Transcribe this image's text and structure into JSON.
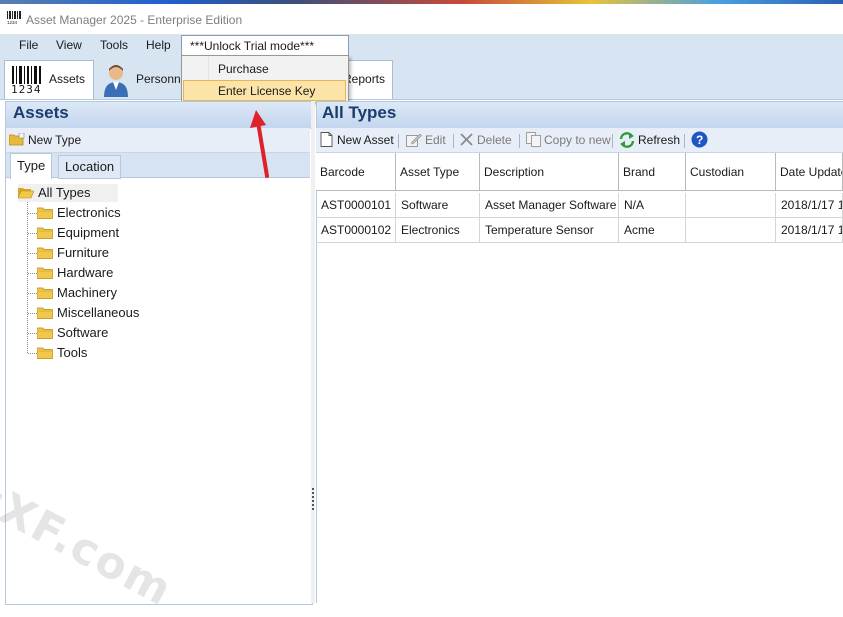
{
  "window": {
    "title": "Asset Manager 2025 - Enterprise Edition"
  },
  "menu": {
    "items": [
      "File",
      "View",
      "Tools",
      "Help"
    ],
    "unlock": "***Unlock Trial mode***"
  },
  "dropdown": {
    "items": [
      "Purchase",
      "Enter License Key"
    ],
    "highlighted": "Enter License Key"
  },
  "ribbon": {
    "tabs": [
      {
        "label": "Assets",
        "icon": "barcode-icon",
        "barcode_digits": "1234"
      },
      {
        "label": "Personn",
        "icon": "person-icon"
      },
      {
        "label": "Reports",
        "icon": "report-icon"
      }
    ]
  },
  "left": {
    "title": "Assets",
    "new_type": "New Type",
    "tabs": [
      "Type",
      "Location"
    ],
    "tree_root": "All Types",
    "tree_children": [
      "Electronics",
      "Equipment",
      "Furniture",
      "Hardware",
      "Machinery",
      "Miscellaneous",
      "Software",
      "Tools"
    ]
  },
  "right": {
    "title": "All Types",
    "toolbar": {
      "new_asset": "New Asset",
      "edit": "Edit",
      "delete": "Delete",
      "copy_to_new": "Copy to new",
      "refresh": "Refresh"
    },
    "columns": [
      "Barcode",
      "Asset Type",
      "Description",
      "Brand",
      "Custodian",
      "Date Update"
    ],
    "rows": [
      [
        "AST0000101",
        "Software",
        "Asset Manager Software",
        "N/A",
        "",
        "2018/1/17 1..."
      ],
      [
        "AST0000102",
        "Electronics",
        "Temperature Sensor",
        "Acme",
        "",
        "2018/1/17 1..."
      ]
    ]
  },
  "watermark": "cXF.com",
  "colors": {
    "menubar": "#d7e4f2",
    "panel_title": "#1a3d6e",
    "highlight": "#fce3a8",
    "arrow": "#e0202a"
  }
}
